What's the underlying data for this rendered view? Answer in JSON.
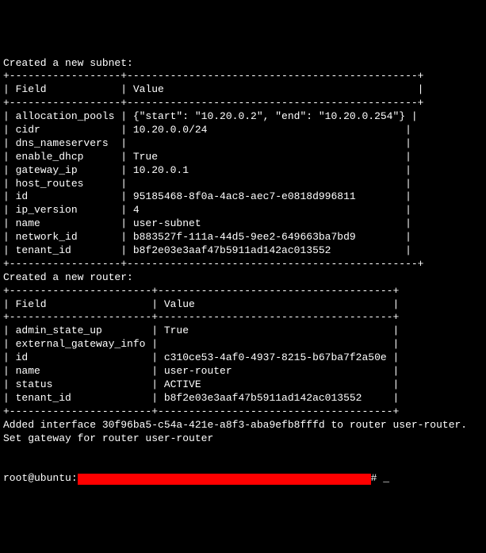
{
  "header_subnet": "Created a new subnet:",
  "table1": {
    "border_top": "+------------------+-----------------------------------------------+",
    "header_row": "| Field            | Value                                         |",
    "border_mid": "+------------------+-----------------------------------------------+",
    "rows": [
      "| allocation_pools | {\"start\": \"10.20.0.2\", \"end\": \"10.20.0.254\"} |",
      "| cidr             | 10.20.0.0/24                                |",
      "| dns_nameservers  |                                             |",
      "| enable_dhcp      | True                                        |",
      "| gateway_ip       | 10.20.0.1                                   |",
      "| host_routes      |                                             |",
      "| id               | 95185468-8f0a-4ac8-aec7-e0818d996811        |",
      "| ip_version       | 4                                           |",
      "| name             | user-subnet                                 |",
      "| network_id       | b883527f-111a-44d5-9ee2-649663ba7bd9        |",
      "| tenant_id        | b8f2e03e3aaf47b5911ad142ac013552            |"
    ],
    "border_bot": "+------------------+-----------------------------------------------+"
  },
  "header_router": "Created a new router:",
  "table2": {
    "border_top": "+-----------------------+--------------------------------------+",
    "header_row": "| Field                 | Value                                |",
    "border_mid": "+-----------------------+--------------------------------------+",
    "rows": [
      "| admin_state_up        | True                                 |",
      "| external_gateway_info |                                      |",
      "| id                    | c310ce53-4af0-4937-8215-b67ba7f2a50e |",
      "| name                  | user-router                          |",
      "| status                | ACTIVE                               |",
      "| tenant_id             | b8f2e03e3aaf47b5911ad142ac013552     |"
    ],
    "border_bot": "+-----------------------+--------------------------------------+"
  },
  "footer_lines": [
    "Added interface 30f96ba5-c54a-421e-a8f3-aba9efb8fffd to router user-router.",
    "Set gateway for router user-router"
  ],
  "prompt": {
    "user": "root@ubuntu:",
    "hash": "# ",
    "cursor": "_"
  }
}
